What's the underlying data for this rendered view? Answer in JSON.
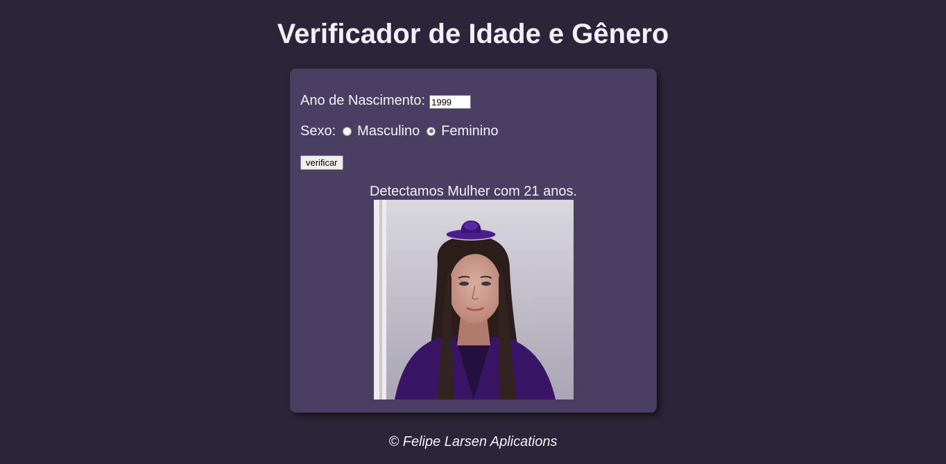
{
  "page": {
    "title": "Verificador de Idade e Gênero",
    "background_color": "#2a2538",
    "card_color": "#4a3f62"
  },
  "form": {
    "year_label": "Ano de Nascimento:",
    "year_value": "1999",
    "sex_label": "Sexo:",
    "options": [
      {
        "label": "Masculino",
        "checked": false
      },
      {
        "label": "Feminino",
        "checked": true
      }
    ],
    "submit_label": "verificar"
  },
  "result": {
    "message": "Detectamos Mulher com 21 anos.",
    "image_description_icon": "young-woman-photo"
  },
  "footer": {
    "text": "© Felipe Larsen Aplications"
  }
}
